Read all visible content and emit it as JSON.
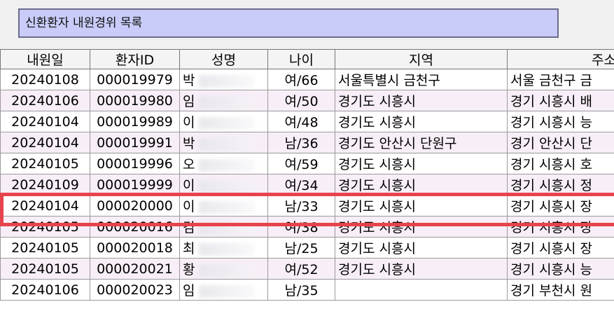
{
  "title": "신환환자 내원경위 목록",
  "columns": [
    "내원일",
    "환자ID",
    "성명",
    "나이",
    "지역",
    "주소"
  ],
  "rows": [
    {
      "date": "20240108",
      "id": "000019979",
      "name": "박",
      "age": "여/66",
      "region": "서울특별시 금천구",
      "address": "서울 금천구 금"
    },
    {
      "date": "20240106",
      "id": "000019980",
      "name": "임",
      "age": "여/50",
      "region": "경기도 시흥시",
      "address": "경기 시흥시 배"
    },
    {
      "date": "20240104",
      "id": "000019989",
      "name": "이",
      "age": "여/48",
      "region": "경기도 시흥시",
      "address": "경기 시흥시 능"
    },
    {
      "date": "20240104",
      "id": "000019991",
      "name": "박",
      "age": "남/36",
      "region": "경기도 안산시 단원구",
      "address": "경기 안산시 단"
    },
    {
      "date": "20240105",
      "id": "000019996",
      "name": "오",
      "age": "여/59",
      "region": "경기도 시흥시",
      "address": "경기 시흥시 호"
    },
    {
      "date": "20240109",
      "id": "000019999",
      "name": "이",
      "age": "여/34",
      "region": "경기도 시흥시",
      "address": "경기 시흥시 정"
    },
    {
      "date": "20240104",
      "id": "000020000",
      "name": "이",
      "age": "남/33",
      "region": "경기도 시흥시",
      "address": "경기 시흥시 장"
    },
    {
      "date": "20240105",
      "id": "000020016",
      "name": "김",
      "age": "여/38",
      "region": "경기도 시흥시",
      "address": "경기 시흥시 장"
    },
    {
      "date": "20240105",
      "id": "000020018",
      "name": "최",
      "age": "남/25",
      "region": "경기도 시흥시",
      "address": "경기 시흥시 장"
    },
    {
      "date": "20240105",
      "id": "000020021",
      "name": "황",
      "age": "여/52",
      "region": "경기도 시흥시",
      "address": "경기 시흥시 능"
    },
    {
      "date": "20240106",
      "id": "000020023",
      "name": "임",
      "age": "남/35",
      "region": "",
      "address": "경기 부천시 원"
    }
  ],
  "highlight_color": "#e8434d",
  "title_bg": "#c9ccf8"
}
